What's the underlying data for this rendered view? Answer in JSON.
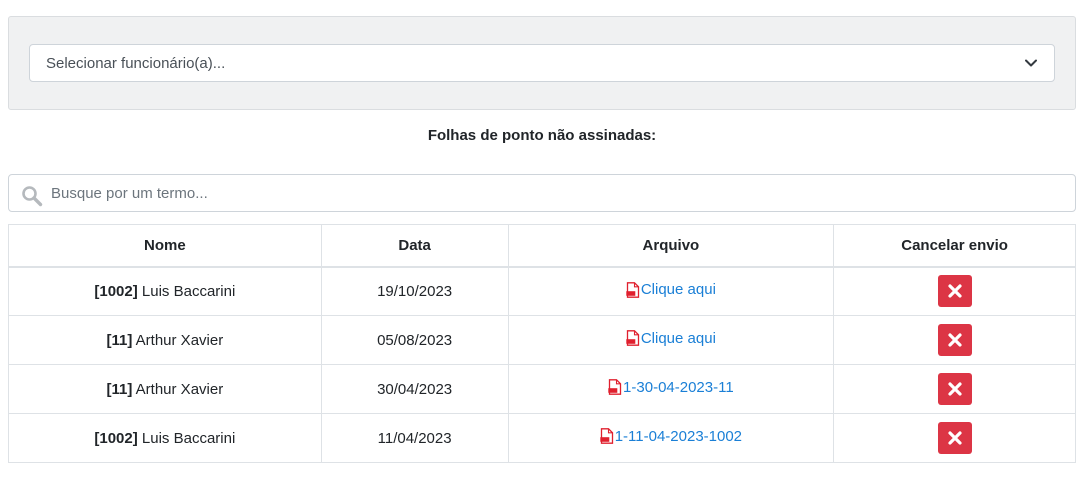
{
  "employee_select": {
    "placeholder": "Selecionar funcionário(a)..."
  },
  "section_title": "Folhas de ponto não assinadas:",
  "search": {
    "placeholder": "Busque por um termo..."
  },
  "table": {
    "headers": [
      "Nome",
      "Data",
      "Arquivo",
      "Cancelar envio"
    ],
    "rows": [
      {
        "code": "[1002]",
        "name": "Luis Baccarini",
        "date": "19/10/2023",
        "file": "Clique aqui"
      },
      {
        "code": "[11]",
        "name": "Arthur Xavier",
        "date": "05/08/2023",
        "file": "Clique aqui"
      },
      {
        "code": "[11]",
        "name": "Arthur Xavier",
        "date": "30/04/2023",
        "file": "1-30-04-2023-11"
      },
      {
        "code": "[1002]",
        "name": "Luis Baccarini",
        "date": "11/04/2023",
        "file": "1-11-04-2023-1002"
      }
    ]
  },
  "icons": {
    "search": "search-icon",
    "pdf": "pdf-file-icon",
    "cancel": "close-icon",
    "select": "chevron-down-icon"
  },
  "colors": {
    "panel_bg": "#f0f1f2",
    "link": "#1a7fd6",
    "danger": "#dc3545",
    "pdf_red": "#e0202e"
  }
}
